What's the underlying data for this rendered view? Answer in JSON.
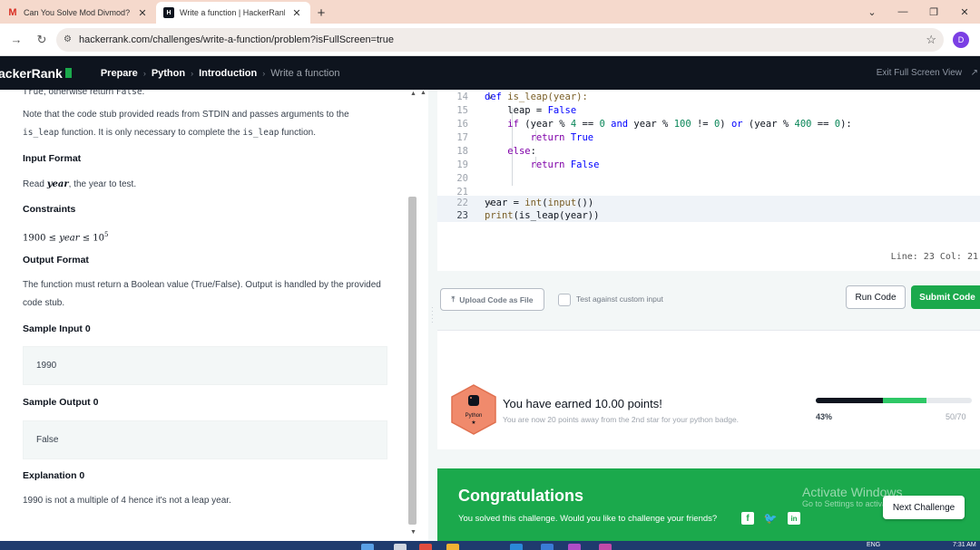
{
  "browser": {
    "tabs": [
      {
        "title": "Can You Solve Mod Divmod? -",
        "active": false,
        "favicon": "gmail-icon"
      },
      {
        "title": "Write a function | HackerRank",
        "active": true,
        "favicon": "hackerrank-icon"
      }
    ],
    "url": "hackerrank.com/challenges/write-a-function/problem?isFullScreen=true",
    "profile_initial": "D"
  },
  "nav": {
    "logo": "ackerRank",
    "breadcrumbs": [
      "Prepare",
      "Python",
      "Introduction",
      "Write a function"
    ],
    "exit_label": "Exit Full Screen View"
  },
  "problem": {
    "intro_pre": "True",
    "intro_mid": ", otherwise return ",
    "intro_code": "False",
    "intro_end": ".",
    "note_1": "Note that the code stub provided reads from STDIN and passes arguments to the",
    "note_code_a": "is_leap",
    "note_2": " function. It is only necessary to complete the ",
    "note_code_b": "is_leap",
    "note_3": " function.",
    "input_heading": "Input Format",
    "input_pre": "Read ",
    "input_var": "year",
    "input_post": ", the year to test.",
    "constraints_heading": "Constraints",
    "constraint_low": "1900",
    "constraint_op": "≤",
    "constraint_var": "year",
    "constraint_base": "10",
    "constraint_exp": "5",
    "output_heading": "Output Format",
    "output_text": "The function must return a Boolean value (True/False). Output is handled by the provided code stub.",
    "sample_input_heading": "Sample Input 0",
    "sample_input": "1990",
    "sample_output_heading": "Sample Output 0",
    "sample_output": "False",
    "explanation_heading": "Explanation 0",
    "explanation_text": "1990 is not a multiple of 4 hence it's not a leap year."
  },
  "editor": {
    "line_numbers": [
      "14",
      "15",
      "16",
      "17",
      "18",
      "19",
      "20",
      "21",
      "22",
      "23"
    ],
    "l14_kw": "def",
    "l14_rest": " is_leap(year):",
    "l15_a": "leap = ",
    "l15_kw": "False",
    "l16_kw": "if",
    "l16_a": " (year % ",
    "l16_n1": "4",
    "l16_b": " == ",
    "l16_n2": "0",
    "l16_and": " and",
    "l16_c": " year % ",
    "l16_n3": "100",
    "l16_d": " != ",
    "l16_n4": "0",
    "l16_e": ") ",
    "l16_or": "or",
    "l16_f": " (year % ",
    "l16_n5": "400",
    "l16_g": " == ",
    "l16_n6": "0",
    "l16_h": "):",
    "l17_kw": "return",
    "l17_val": " True",
    "l18_kw": "else",
    "l18_colon": ":",
    "l19_kw": "return",
    "l19_val": " False",
    "l22_a": "year = ",
    "l22_fn": "int",
    "l22_b": "(",
    "l22_fn2": "input",
    "l22_c": "())",
    "l23_fn": "print",
    "l23_rest": "(is_leap(year))",
    "status": "Line: 23 Col: 21"
  },
  "actions": {
    "upload_label": "Upload Code as File",
    "custom_input_label": "Test against custom input",
    "run_label": "Run Code",
    "submit_label": "Submit Code"
  },
  "result": {
    "badge_name": "Python",
    "earned": "You have earned 10.00 points!",
    "subtext": "You are now 20 points away from the 2nd star for your python badge.",
    "progress_percent": "43%",
    "progress_fraction_before": 0.43,
    "progress_fraction_after": 0.71,
    "points": "50/70"
  },
  "congrats": {
    "title": "Congratulations",
    "subtitle": "You solved this challenge. Would you like to challenge your friends?",
    "next_label": "Next Challenge",
    "watermark_1": "Activate Windows",
    "watermark_2": "Go to Settings to activate Windows."
  },
  "taskbar": {
    "lang": "ENG",
    "time": "7:31 AM"
  },
  "colors": {
    "brand_green": "#1ba94c",
    "nav_dark": "#0e141e",
    "badge_orange": "#f08a6c"
  }
}
